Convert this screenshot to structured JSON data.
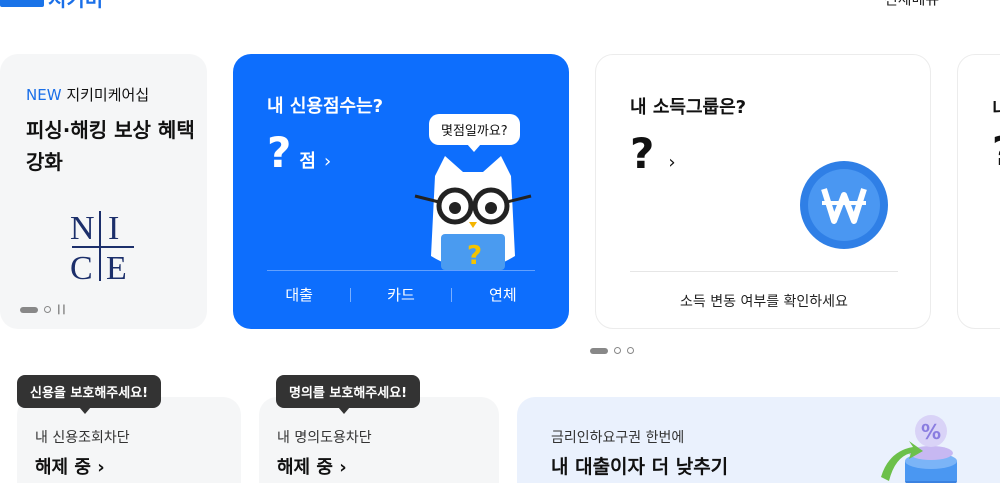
{
  "header": {
    "logo_text": "지키미",
    "menu_label": "전체메뉴",
    "menu_icon": "hamburger-icon"
  },
  "promo_card": {
    "new_badge": "NEW",
    "new_text": "지키미케어십",
    "title": "피싱·해킹 보상 혜택 강화",
    "logo_text": "NICE"
  },
  "credit_card": {
    "title": "내 신용점수는?",
    "score": "?",
    "unit": "점",
    "bubble": "몇점일까요?",
    "tabs": [
      "대출",
      "카드",
      "연체"
    ]
  },
  "income_card": {
    "title": "내 소득그룹은?",
    "value": "?",
    "link": "소득 변동 여부를 확인하세요",
    "coin_icon": "won-coin-icon"
  },
  "next_card": {
    "title": "니",
    "value": "?"
  },
  "protect_cards": [
    {
      "tip": "신용을 보호해주세요!",
      "label": "내 신용조회차단",
      "status": "해제 중"
    },
    {
      "tip": "명의를 보호해주세요!",
      "label": "내 명의도용차단",
      "status": "해제 중"
    }
  ],
  "loan_card": {
    "subtitle": "금리인하요구권 한번에",
    "title": "내 대출이자 더 낮추기"
  },
  "colors": {
    "brand_blue": "#0d6efd",
    "card_gray": "#f5f6f7",
    "tooltip_dark": "#333333",
    "loan_bg": "#eaf1fd"
  }
}
